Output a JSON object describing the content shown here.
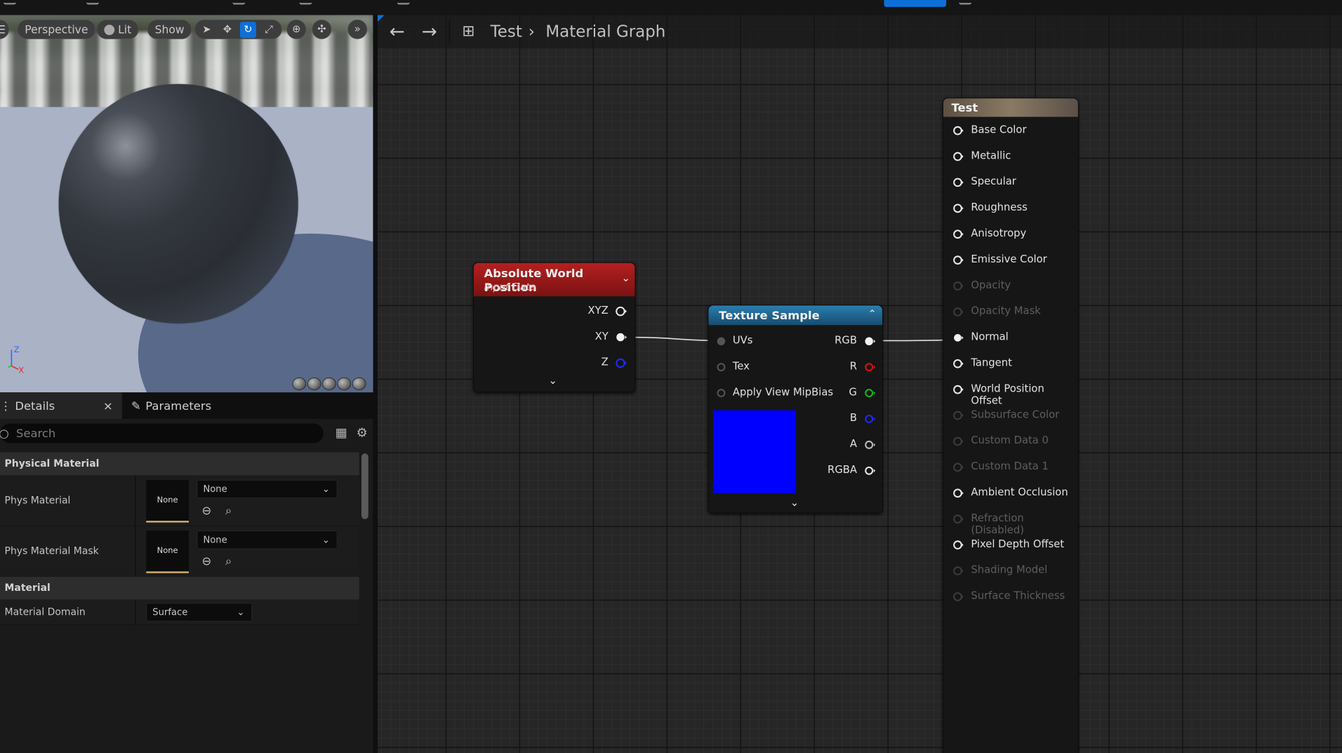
{
  "viewport": {
    "toolbar": {
      "perspective": "Perspective",
      "lit": "Lit",
      "show": "Show"
    },
    "axis": {
      "z": "Z",
      "x": "X"
    }
  },
  "details": {
    "tabs": {
      "details": "Details",
      "parameters": "Parameters"
    },
    "search_placeholder": "Search",
    "categories": {
      "physical_material": "Physical Material",
      "material": "Material"
    },
    "rows": [
      {
        "label": "Phys Material",
        "thumb": "None",
        "value": "None"
      },
      {
        "label": "Phys Material Mask",
        "thumb": "None",
        "value": "None"
      }
    ],
    "material_domain": {
      "label": "Material Domain",
      "value": "Surface"
    }
  },
  "graph": {
    "breadcrumb": {
      "asset": "Test",
      "view": "Material Graph"
    },
    "awp_node": {
      "title": "Absolute World Position",
      "subtitle": "Input Data",
      "outputs": [
        "XYZ",
        "XY",
        "Z"
      ]
    },
    "texture_node": {
      "title": "Texture Sample",
      "inputs": [
        "UVs",
        "Tex",
        "Apply View MipBias"
      ],
      "outputs": [
        "RGB",
        "R",
        "G",
        "B",
        "A",
        "RGBA"
      ]
    },
    "result_node": {
      "title": "Test",
      "pins": [
        {
          "label": "Base Color",
          "enabled": true
        },
        {
          "label": "Metallic",
          "enabled": true
        },
        {
          "label": "Specular",
          "enabled": true
        },
        {
          "label": "Roughness",
          "enabled": true
        },
        {
          "label": "Anisotropy",
          "enabled": true
        },
        {
          "label": "Emissive Color",
          "enabled": true
        },
        {
          "label": "Opacity",
          "enabled": false
        },
        {
          "label": "Opacity Mask",
          "enabled": false
        },
        {
          "label": "Normal",
          "enabled": true,
          "connected": true
        },
        {
          "label": "Tangent",
          "enabled": true
        },
        {
          "label": "World Position Offset",
          "enabled": true
        },
        {
          "label": "Subsurface Color",
          "enabled": false
        },
        {
          "label": "Custom Data 0",
          "enabled": false
        },
        {
          "label": "Custom Data 1",
          "enabled": false
        },
        {
          "label": "Ambient Occlusion",
          "enabled": true
        },
        {
          "label": "Refraction (Disabled)",
          "enabled": false
        },
        {
          "label": "Pixel Depth Offset",
          "enabled": true
        },
        {
          "label": "Shading Model",
          "enabled": false
        },
        {
          "label": "Surface Thickness",
          "enabled": false
        }
      ]
    },
    "colors": {
      "awp_header": "#9b1515",
      "texture_header": "#1d5f86",
      "result_header": "#6b5b46",
      "texture_preview": "#0000ff",
      "pin_r": "#e01010",
      "pin_g": "#10c010",
      "pin_b": "#1a2cff"
    }
  }
}
